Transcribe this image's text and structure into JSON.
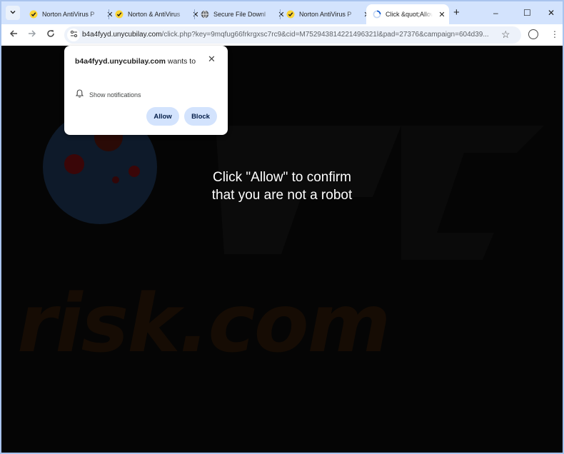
{
  "browser": {
    "tabs": [
      {
        "title": "Norton AntiVirus P",
        "favicon": "norton-icon",
        "active": false
      },
      {
        "title": "Norton & AntiVirus",
        "favicon": "norton-icon",
        "active": false
      },
      {
        "title": "Secure File Downl",
        "favicon": "globe-icon",
        "active": false
      },
      {
        "title": "Norton AntiVirus P",
        "favicon": "norton-icon",
        "active": false
      },
      {
        "title": "Click &quot;Allow",
        "favicon": "loading-icon",
        "active": true
      }
    ],
    "new_tab_symbol": "+",
    "window_controls": {
      "minimize": "–",
      "maximize": "☐",
      "close": "✕"
    },
    "address_bar": {
      "host": "b4a4fyyd.unycubilay.com",
      "path": "/click.php?key=9mqfug66frkrgxsc7rc9&cid=M752943814221496321l&pad=27376&campaign=604d39..."
    }
  },
  "page": {
    "watermark": "risk.com",
    "message_line1": "Click \"Allow\" to confirm",
    "message_line2": "that you are not a robot"
  },
  "permission_prompt": {
    "origin": "b4a4fyyd.unycubilay.com",
    "suffix": " wants to",
    "permission_label": "Show notifications",
    "allow_label": "Allow",
    "block_label": "Block"
  },
  "colors": {
    "tabstrip_bg": "#d3e3fd",
    "prompt_button_bg": "#d3e3fd",
    "page_bg": "#050505"
  }
}
